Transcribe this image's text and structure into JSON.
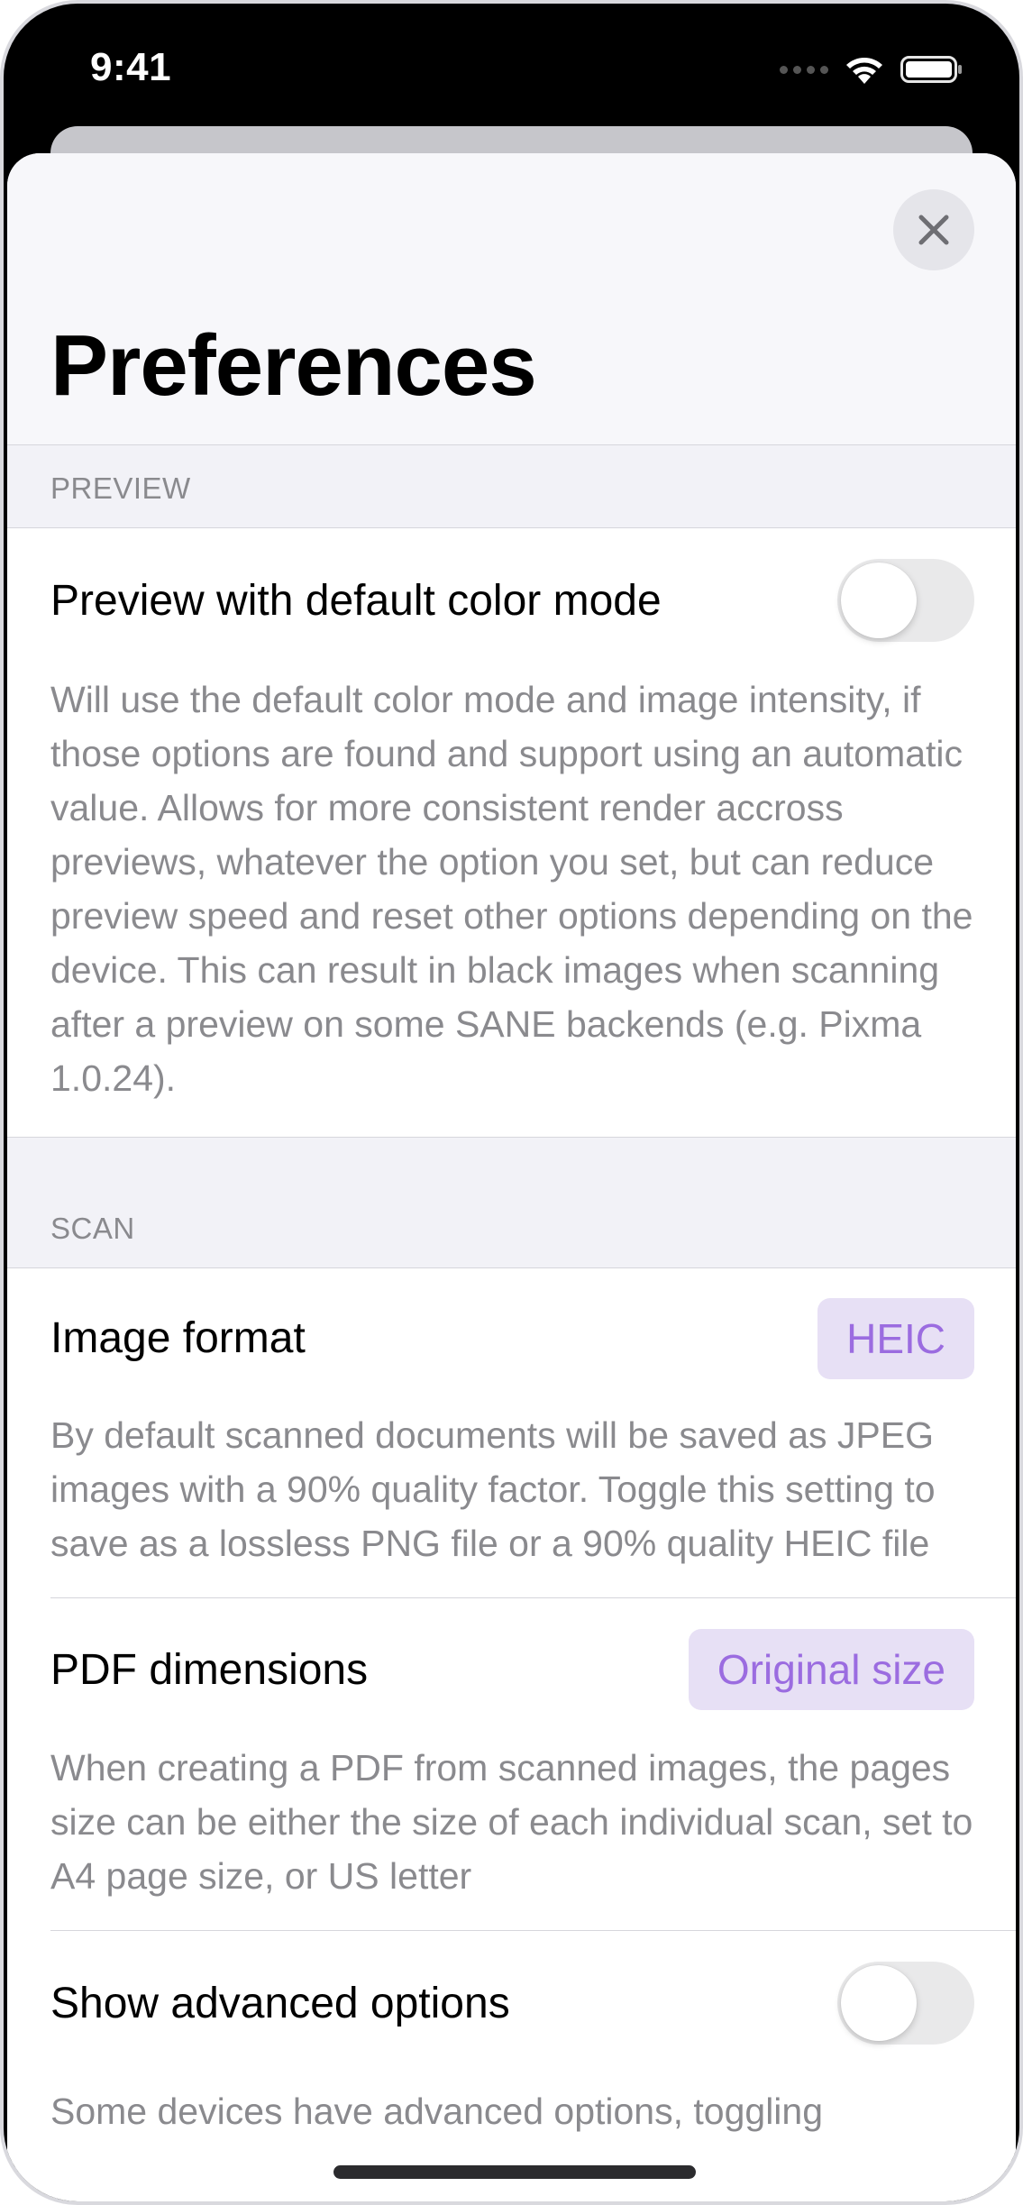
{
  "status_bar": {
    "time": "9:41",
    "icons": [
      "cellular-dots-icon",
      "wifi-icon",
      "battery-icon"
    ]
  },
  "sheet": {
    "title": "Preferences",
    "close_icon": "close-icon",
    "sections": {
      "preview": {
        "header": "PREVIEW",
        "rows": [
          {
            "label": "Preview with default color mode",
            "control": "toggle",
            "toggle_on": false,
            "description": "Will use the default color mode and image intensity, if those options are found and support using an automatic value. Allows for more consistent render accross previews, whatever the option you set, but can reduce preview speed and reset other options depending on the device. This can result in black images when scanning after a preview on some SANE backends (e.g. Pixma 1.0.24)."
          }
        ]
      },
      "scan": {
        "header": "SCAN",
        "rows": [
          {
            "label": "Image format",
            "value": "HEIC",
            "description": "By default scanned documents will be saved as JPEG images with a 90% quality factor. Toggle this setting to save as a lossless PNG file or a 90% quality HEIC file"
          },
          {
            "label": "PDF dimensions",
            "value": "Original size",
            "description": "When creating a PDF from scanned images, the pages size can be either the size of each individual scan, set to A4 page size, or US letter"
          },
          {
            "label": "Show advanced options",
            "control": "toggle",
            "toggle_on": false,
            "description": "Some devices have advanced options, toggling"
          }
        ]
      }
    }
  },
  "colors": {
    "accent": "#9b6ce0",
    "accent_background": "#e7e0f5",
    "secondary_text": "#8a8a8e",
    "grouped_background": "#f2f2f7"
  }
}
